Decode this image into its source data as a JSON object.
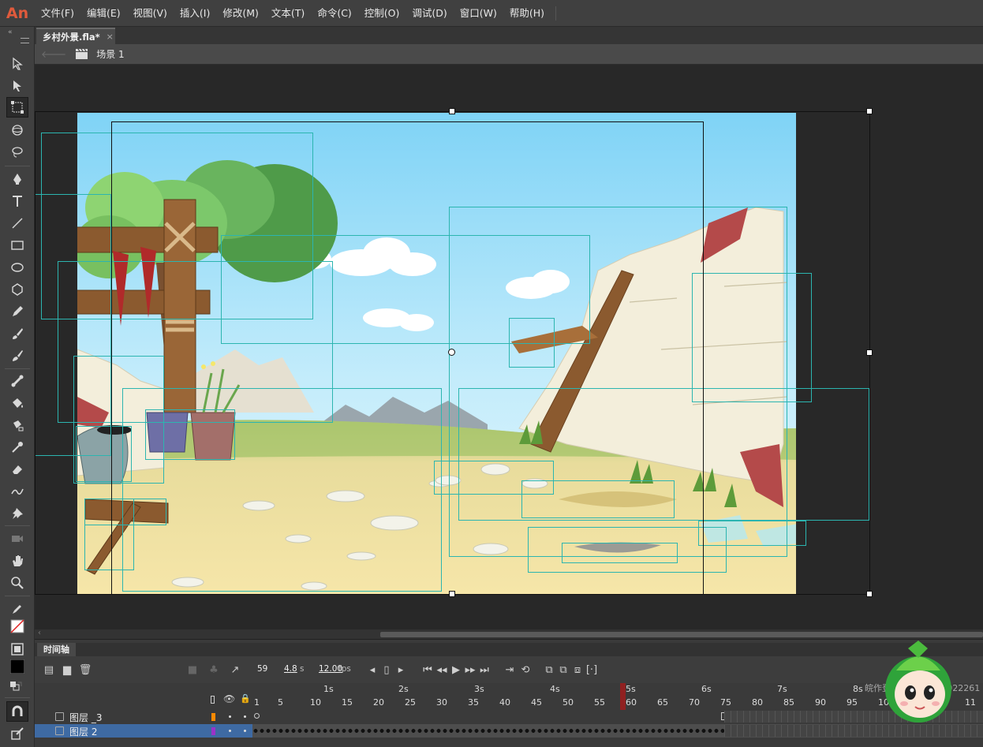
{
  "app": {
    "logo": "An"
  },
  "menu": [
    "文件(F)",
    "编辑(E)",
    "视图(V)",
    "插入(I)",
    "修改(M)",
    "文本(T)",
    "命令(C)",
    "控制(O)",
    "调试(D)",
    "窗口(W)",
    "帮助(H)"
  ],
  "document": {
    "tab_title": "乡村外景.fla*",
    "close_glyph": "×"
  },
  "scene": {
    "label": "场景 1"
  },
  "tools": [
    "selection-icon",
    "subselection-icon",
    "free-transform-icon",
    "3d-rotation-icon",
    "lasso-icon",
    "pen-icon",
    "text-icon",
    "line-icon",
    "rectangle-icon",
    "oval-icon",
    "polystar-icon",
    "pencil-icon",
    "paint-brush-icon",
    "brush-icon",
    "bone-icon",
    "paint-bucket-icon",
    "ink-bottle-icon",
    "eyedropper-icon",
    "eraser-icon",
    "width-icon",
    "pin-icon",
    "camera-icon",
    "hand-icon",
    "zoom-icon",
    "stroke-color-icon",
    "fill-color-icon",
    "snap-icon",
    "object-drawing-icon"
  ],
  "timeline": {
    "tab_label": "时间轴",
    "current_frame": "59",
    "elapsed": "4.8",
    "elapsed_unit": "s",
    "fps": "12.00",
    "fps_unit": "fps",
    "seconds": [
      "1s",
      "2s",
      "3s",
      "4s",
      "5s",
      "6s",
      "7s",
      "8s"
    ],
    "frame_numbers": [
      "1",
      "5",
      "10",
      "15",
      "20",
      "25",
      "30",
      "35",
      "40",
      "45",
      "50",
      "55",
      "60",
      "65",
      "70",
      "75",
      "80",
      "85",
      "90",
      "95",
      "10",
      "11"
    ],
    "layers": [
      {
        "name": "图层 _3",
        "color": "#ff8a00",
        "selected": false
      },
      {
        "name": "图层 2",
        "color": "#9b32c8",
        "selected": true
      }
    ]
  },
  "watermark": "皖作登字-2022-F-00022261",
  "colors": {
    "accent": "#2cb5b0",
    "playhead": "#9a1f1f",
    "selected_row": "#3e6aa3"
  }
}
